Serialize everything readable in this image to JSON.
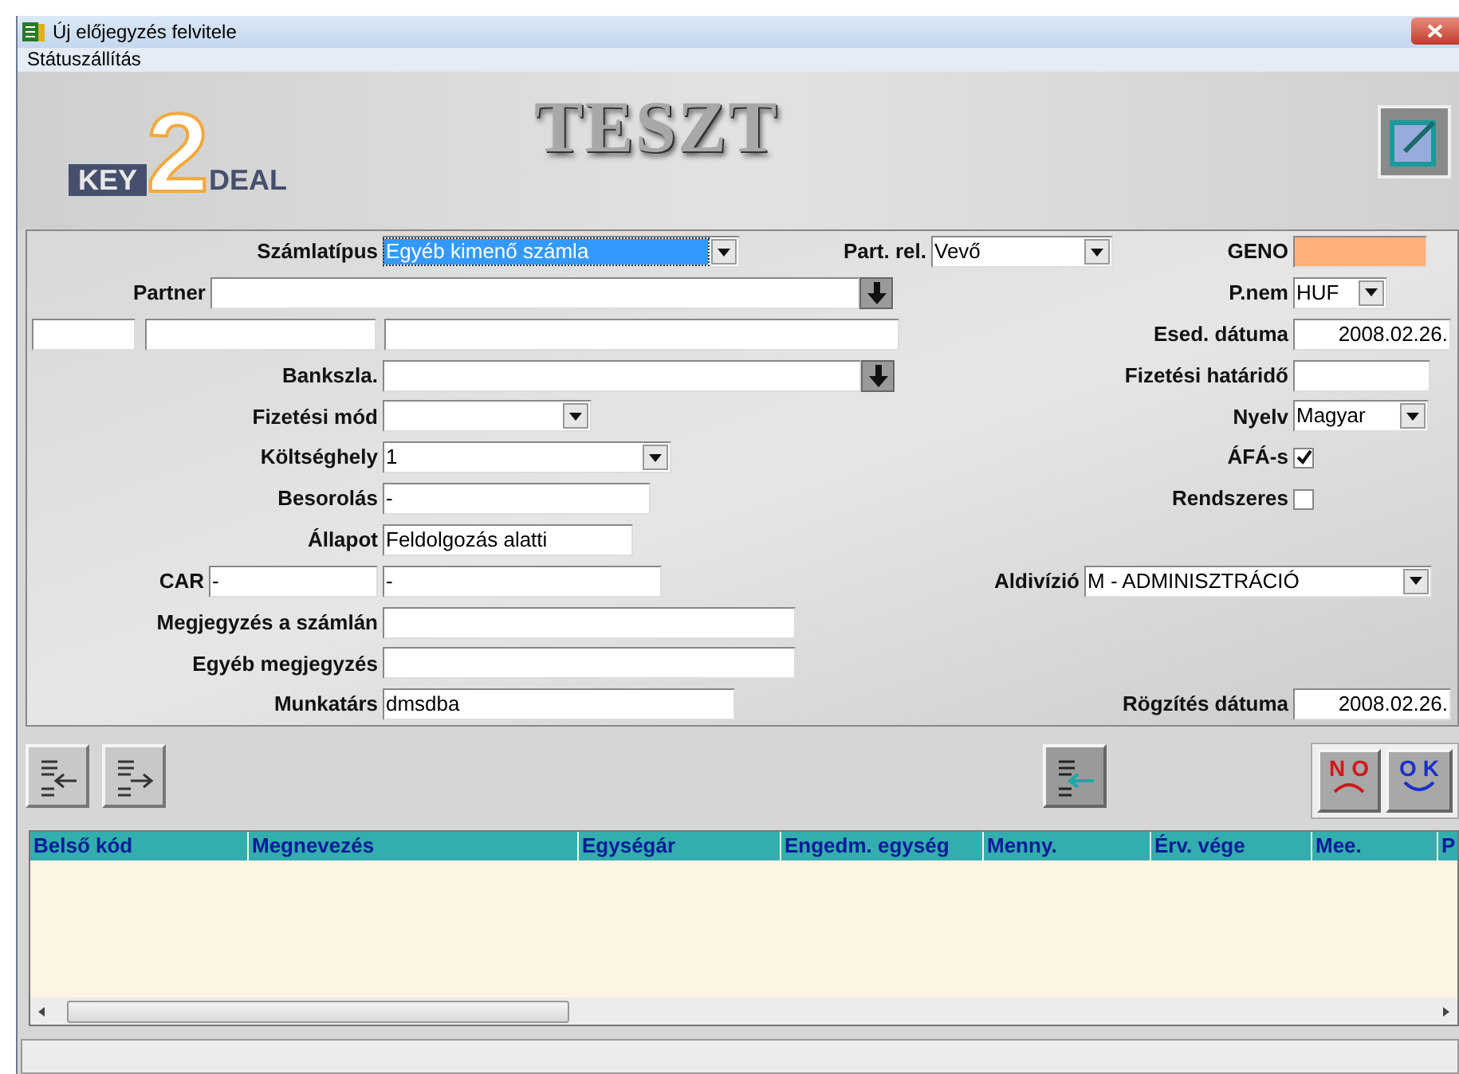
{
  "window": {
    "title": "Új előjegyzés felvitele"
  },
  "menu": [
    {
      "label": "Státuszállítás"
    }
  ],
  "header": {
    "logo_left": "KEY",
    "logo_digit": "2",
    "logo_right": "DEAL",
    "title": "TESZT"
  },
  "form": {
    "szamlatipus": {
      "label": "Számlatípus",
      "value": "Egyéb kimenő számla",
      "highlighted": true
    },
    "part_rel": {
      "label": "Part. rel.",
      "value": "Vevő"
    },
    "geno": {
      "label": "GENO"
    },
    "partner": {
      "label": "Partner"
    },
    "p_nem": {
      "label": "P.nem",
      "value": "HUF"
    },
    "esed_datum": {
      "label": "Esed. dátuma",
      "value": "2008.02.26."
    },
    "bankszla": {
      "label": "Bankszla."
    },
    "fizetesi_hatarido": {
      "label": "Fizetési határidő"
    },
    "fizetesi_mod": {
      "label": "Fizetési mód"
    },
    "nyelv": {
      "label": "Nyelv",
      "value": "Magyar"
    },
    "koltseghely": {
      "label": "Költséghely",
      "value": "1"
    },
    "afas": {
      "label": "ÁFÁ-s",
      "checked": true
    },
    "besorolas": {
      "label": "Besorolás",
      "value": "-"
    },
    "rendszeres": {
      "label": "Rendszeres",
      "checked": false
    },
    "allapot": {
      "label": "Állapot",
      "value": "Feldolgozás alatti"
    },
    "car": {
      "label": "CAR",
      "value_1": "-",
      "value_2": "-"
    },
    "aldivizio": {
      "label": "Aldivízió",
      "value": "M - ADMINISZTRÁCIÓ"
    },
    "megjegyzes": {
      "label": "Megjegyzés a számlán"
    },
    "egyeb_megjegyzes": {
      "label": "Egyéb megjegyzés"
    },
    "munkatars": {
      "label": "Munkatárs",
      "value": "dmsdba"
    },
    "rogzites_datum": {
      "label": "Rögzítés dátuma",
      "value": "2008.02.26."
    }
  },
  "buttons": {
    "no": "NO",
    "ok": "OK"
  },
  "table": {
    "columns": [
      "Belső kód",
      "Megnevezés",
      "Egységár",
      "Engedm. egység",
      "Menny.",
      "Érv. vége",
      "Mee.",
      "P"
    ]
  }
}
